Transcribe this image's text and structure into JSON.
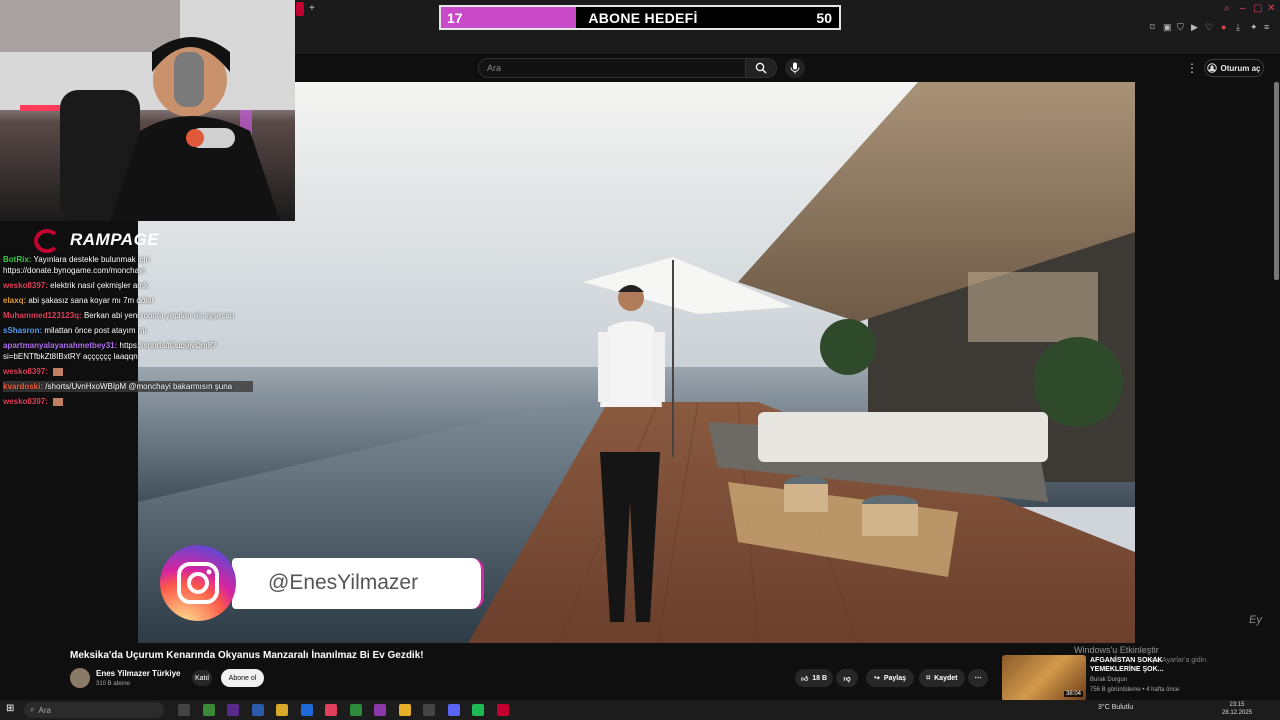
{
  "goal": {
    "current": "17",
    "title": "ABONE HEDEFİ",
    "target": "50",
    "progress_fraction": 0.34,
    "fill_color": "#c84ac8"
  },
  "browser": {
    "new_tab": "+"
  },
  "youtube": {
    "search_placeholder": "Ara",
    "signin_label": "Oturum aç",
    "video_title": "Meksika'da Uçurum Kenarında Okyanus Manzaralı İnanılmaz Bi Ev Gezdik!",
    "channel": {
      "name": "Enes Yilmazer Türkiye",
      "subs": "310 B abone"
    },
    "join_label": "Katıl",
    "subscribe_label": "Abone ol",
    "likes": "18 B",
    "share_label": "Paylaş",
    "save_label": "Kaydet",
    "recommendation": {
      "title": "AFGANİSTAN SOKAK YEMEKLERİNE ŞOK...",
      "channel": "Burak Durgun",
      "meta": "756 B görüntüleme • 4 hafta önce",
      "duration": "38:04"
    }
  },
  "overlay": {
    "brand": "RAMPAGE",
    "instagram_handle": "@EnesYilmazer",
    "watermark": "Ey"
  },
  "chat": [
    {
      "user": "BotRix:",
      "color": "#3ec94a",
      "text": "Yayınlara destekle bulunmak için https://donate.bynogame.com/monchayi",
      "highlight": false
    },
    {
      "user": "wesko8397:",
      "color": "#e0405b",
      "text": "elektrik nasıl çekmişler amk",
      "highlight": false
    },
    {
      "user": "elaxq:",
      "color": "#e0a030",
      "text": "abi şakasız sana koyar mı 7m dolar",
      "highlight": false
    },
    {
      "user": "Muhammed123123q:",
      "color": "#e0405b",
      "text": "Berkan abi yeni montu yapılan ait ayşecan",
      "highlight": false
    },
    {
      "user": "sShasron:",
      "color": "#5aa0f0",
      "text": "milattan önce post atayım mı",
      "highlight": false
    },
    {
      "user": "apartmanyalayanahmetbey31:",
      "color": "#b070f0",
      "text": "https://shorts/tOub9jvDm8?si=bENTfbkZt8IBxtRY açççççç laaqqn",
      "highlight": false
    },
    {
      "user": "wesko8397:",
      "color": "#e0405b",
      "text": "",
      "highlight": false
    },
    {
      "user": "kvardoski:",
      "color": "#f06040",
      "text": "/shorts/UvnHxoWBIpM @monchayi bakarmısın şuna",
      "highlight": true
    },
    {
      "user": "wesko8397:",
      "color": "#e0405b",
      "text": "",
      "highlight": false
    }
  ],
  "windows": {
    "activate_title": "Windows'u Etkinleştir",
    "activate_sub": "için Ayarlar'a gidin.",
    "taskbar_search": "Ara",
    "weather": "3°C  Bulutlu",
    "time": "23:15",
    "date": "28.12.2025"
  }
}
